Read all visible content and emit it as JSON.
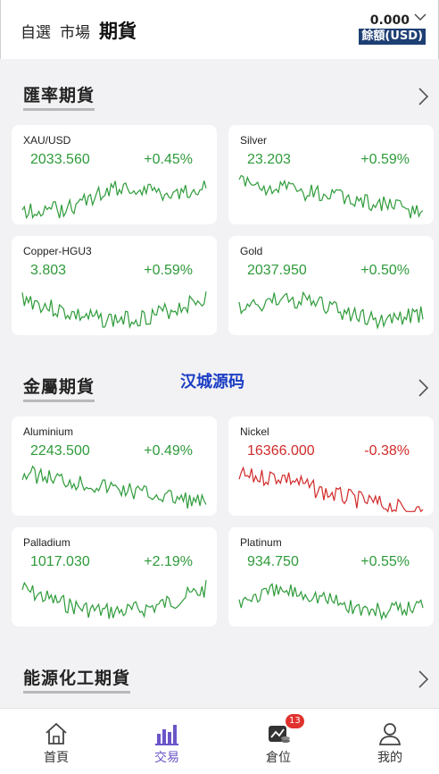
{
  "header": {
    "tabs": [
      {
        "label": "自選"
      },
      {
        "label": "市場"
      },
      {
        "label": "期貨"
      }
    ],
    "balance": {
      "value": "0.000",
      "label": "餘額(USD)"
    }
  },
  "sections": [
    {
      "title": "匯率期貨",
      "items": [
        {
          "name": "XAU/USD",
          "price": "2033.560",
          "change": "+0.45%",
          "trend": "up"
        },
        {
          "name": "Silver",
          "price": "23.203",
          "change": "+0.59%",
          "trend": "up"
        },
        {
          "name": "Copper-HGU3",
          "price": "3.803",
          "change": "+0.59%",
          "trend": "up"
        },
        {
          "name": "Gold",
          "price": "2037.950",
          "change": "+0.50%",
          "trend": "up"
        }
      ]
    },
    {
      "title": "金屬期貨",
      "items": [
        {
          "name": "Aluminium",
          "price": "2243.500",
          "change": "+0.49%",
          "trend": "up"
        },
        {
          "name": "Nickel",
          "price": "16366.000",
          "change": "-0.38%",
          "trend": "down"
        },
        {
          "name": "Palladium",
          "price": "1017.030",
          "change": "+2.19%",
          "trend": "up"
        },
        {
          "name": "Platinum",
          "price": "934.750",
          "change": "+0.55%",
          "trend": "up"
        }
      ]
    },
    {
      "title": "能源化工期貨",
      "items": []
    }
  ],
  "watermark": "汉城源码",
  "bottom_nav": {
    "items": [
      {
        "label": "首頁",
        "icon": "home-icon"
      },
      {
        "label": "交易",
        "icon": "bar-chart-icon",
        "active": true
      },
      {
        "label": "倉位",
        "icon": "position-icon",
        "badge": "13"
      },
      {
        "label": "我的",
        "icon": "user-icon"
      }
    ]
  },
  "colors": {
    "up": "#2e9b3a",
    "down": "#d12a2a",
    "balance_bg": "#1e3f73",
    "active_nav": "#6b55c8",
    "badge": "#e0322e"
  }
}
